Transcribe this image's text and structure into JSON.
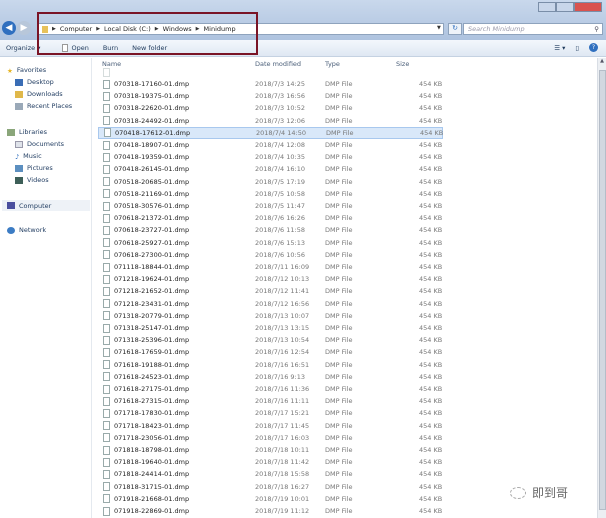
{
  "address": {
    "crumbs": [
      "Computer",
      "Local Disk (C:)",
      "Windows",
      "Minidump"
    ]
  },
  "search": {
    "placeholder": "Search Minidump"
  },
  "toolbar": {
    "organize": "Organize ▾",
    "open": "Open",
    "burn": "Burn",
    "new_folder": "New folder"
  },
  "sidebar": {
    "favorites": "Favorites",
    "desktop": "Desktop",
    "downloads": "Downloads",
    "recent": "Recent Places",
    "libraries": "Libraries",
    "documents": "Documents",
    "music": "Music",
    "pictures": "Pictures",
    "videos": "Videos",
    "computer": "Computer",
    "network": "Network"
  },
  "columns": {
    "name": "Name",
    "date": "Date modified",
    "type": "Type",
    "size": "Size"
  },
  "files": [
    {
      "name": "070318-17160-01.dmp",
      "date": "2018/7/3 14:25",
      "type": "DMP File",
      "size": "454 KB"
    },
    {
      "name": "070318-19375-01.dmp",
      "date": "2018/7/3 16:56",
      "type": "DMP File",
      "size": "454 KB"
    },
    {
      "name": "070318-22620-01.dmp",
      "date": "2018/7/3 10:52",
      "type": "DMP File",
      "size": "454 KB"
    },
    {
      "name": "070318-24492-01.dmp",
      "date": "2018/7/3 12:06",
      "type": "DMP File",
      "size": "454 KB"
    },
    {
      "name": "070418-17612-01.dmp",
      "date": "2018/7/4 14:50",
      "type": "DMP File",
      "size": "454 KB"
    },
    {
      "name": "070418-18907-01.dmp",
      "date": "2018/7/4 12:08",
      "type": "DMP File",
      "size": "454 KB"
    },
    {
      "name": "070418-19359-01.dmp",
      "date": "2018/7/4 10:35",
      "type": "DMP File",
      "size": "454 KB"
    },
    {
      "name": "070418-26145-01.dmp",
      "date": "2018/7/4 16:10",
      "type": "DMP File",
      "size": "454 KB"
    },
    {
      "name": "070518-20685-01.dmp",
      "date": "2018/7/5 17:19",
      "type": "DMP File",
      "size": "454 KB"
    },
    {
      "name": "070518-21169-01.dmp",
      "date": "2018/7/5 10:58",
      "type": "DMP File",
      "size": "454 KB"
    },
    {
      "name": "070518-30576-01.dmp",
      "date": "2018/7/5 11:47",
      "type": "DMP File",
      "size": "454 KB"
    },
    {
      "name": "070618-21372-01.dmp",
      "date": "2018/7/6 16:26",
      "type": "DMP File",
      "size": "454 KB"
    },
    {
      "name": "070618-23727-01.dmp",
      "date": "2018/7/6 11:58",
      "type": "DMP File",
      "size": "454 KB"
    },
    {
      "name": "070618-25927-01.dmp",
      "date": "2018/7/6 15:13",
      "type": "DMP File",
      "size": "454 KB"
    },
    {
      "name": "070618-27300-01.dmp",
      "date": "2018/7/6 10:56",
      "type": "DMP File",
      "size": "454 KB"
    },
    {
      "name": "071118-18844-01.dmp",
      "date": "2018/7/11 16:09",
      "type": "DMP File",
      "size": "454 KB"
    },
    {
      "name": "071218-19624-01.dmp",
      "date": "2018/7/12 10:13",
      "type": "DMP File",
      "size": "454 KB"
    },
    {
      "name": "071218-21652-01.dmp",
      "date": "2018/7/12 11:41",
      "type": "DMP File",
      "size": "454 KB"
    },
    {
      "name": "071218-23431-01.dmp",
      "date": "2018/7/12 16:56",
      "type": "DMP File",
      "size": "454 KB"
    },
    {
      "name": "071318-20779-01.dmp",
      "date": "2018/7/13 10:07",
      "type": "DMP File",
      "size": "454 KB"
    },
    {
      "name": "071318-25147-01.dmp",
      "date": "2018/7/13 13:15",
      "type": "DMP File",
      "size": "454 KB"
    },
    {
      "name": "071318-25396-01.dmp",
      "date": "2018/7/13 10:54",
      "type": "DMP File",
      "size": "454 KB"
    },
    {
      "name": "071618-17659-01.dmp",
      "date": "2018/7/16 12:54",
      "type": "DMP File",
      "size": "454 KB"
    },
    {
      "name": "071618-19188-01.dmp",
      "date": "2018/7/16 16:51",
      "type": "DMP File",
      "size": "454 KB"
    },
    {
      "name": "071618-24523-01.dmp",
      "date": "2018/7/16 9:13",
      "type": "DMP File",
      "size": "454 KB"
    },
    {
      "name": "071618-27175-01.dmp",
      "date": "2018/7/16 11:36",
      "type": "DMP File",
      "size": "454 KB"
    },
    {
      "name": "071618-27315-01.dmp",
      "date": "2018/7/16 11:11",
      "type": "DMP File",
      "size": "454 KB"
    },
    {
      "name": "071718-17830-01.dmp",
      "date": "2018/7/17 15:21",
      "type": "DMP File",
      "size": "454 KB"
    },
    {
      "name": "071718-18423-01.dmp",
      "date": "2018/7/17 11:45",
      "type": "DMP File",
      "size": "454 KB"
    },
    {
      "name": "071718-23056-01.dmp",
      "date": "2018/7/17 16:03",
      "type": "DMP File",
      "size": "454 KB"
    },
    {
      "name": "071818-18798-01.dmp",
      "date": "2018/7/18 10:11",
      "type": "DMP File",
      "size": "454 KB"
    },
    {
      "name": "071818-19640-01.dmp",
      "date": "2018/7/18 11:42",
      "type": "DMP File",
      "size": "454 KB"
    },
    {
      "name": "071818-24414-01.dmp",
      "date": "2018/7/18 15:58",
      "type": "DMP File",
      "size": "454 KB"
    },
    {
      "name": "071818-31715-01.dmp",
      "date": "2018/7/18 16:27",
      "type": "DMP File",
      "size": "454 KB"
    },
    {
      "name": "071918-21668-01.dmp",
      "date": "2018/7/19 10:01",
      "type": "DMP File",
      "size": "454 KB"
    },
    {
      "name": "071918-22869-01.dmp",
      "date": "2018/7/19 11:12",
      "type": "DMP File",
      "size": "454 KB"
    }
  ],
  "selected_index": 4,
  "watermark": "即到哥"
}
